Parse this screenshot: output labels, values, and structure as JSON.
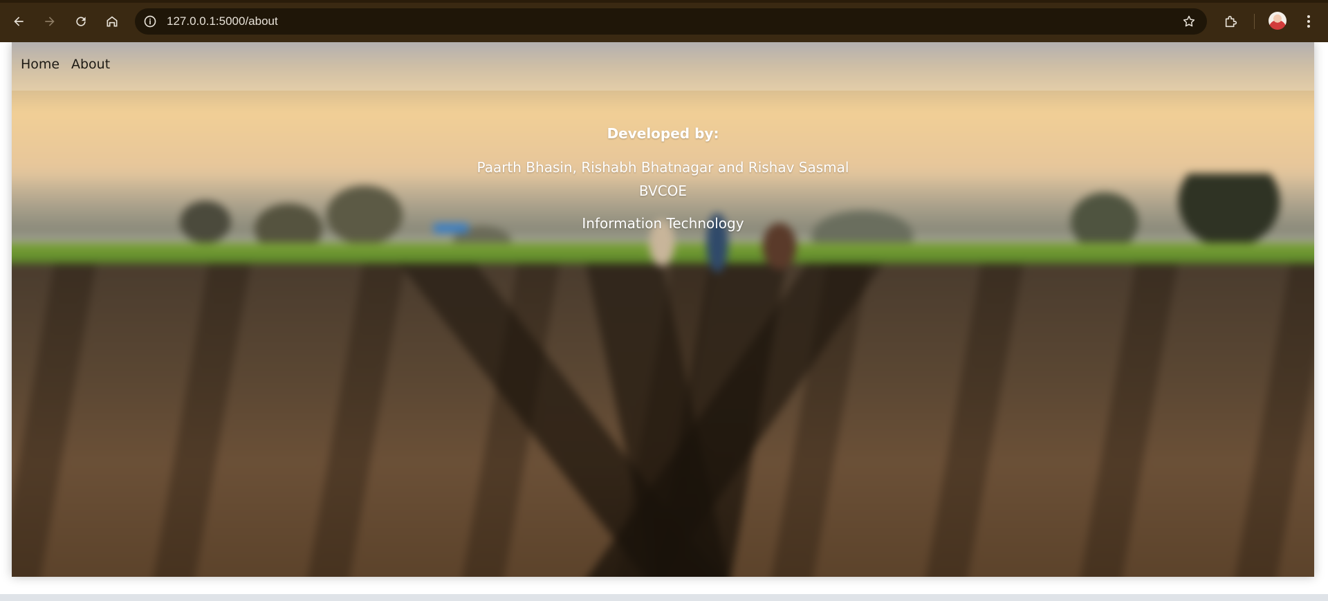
{
  "browser": {
    "url": "127.0.0.1:5000/about",
    "icons": {
      "back": "arrow-left-icon",
      "forward": "arrow-right-icon",
      "reload": "reload-icon",
      "home": "home-icon",
      "site_info": "info-icon",
      "bookmark": "star-icon",
      "extensions": "puzzle-icon",
      "profile": "avatar",
      "menu": "kebab-menu-icon"
    },
    "colors": {
      "toolbar": "#3a2912",
      "omnibox": "#1f1608",
      "text": "#e8e2d8"
    }
  },
  "navbar": {
    "links": [
      {
        "label": "Home"
      },
      {
        "label": "About"
      }
    ]
  },
  "about": {
    "heading": "Developed by:",
    "names": "Paarth Bhasin, Rishabh Bhatnagar and Rishav Sasmal",
    "college": "BVCOE",
    "department": "Information Technology"
  }
}
